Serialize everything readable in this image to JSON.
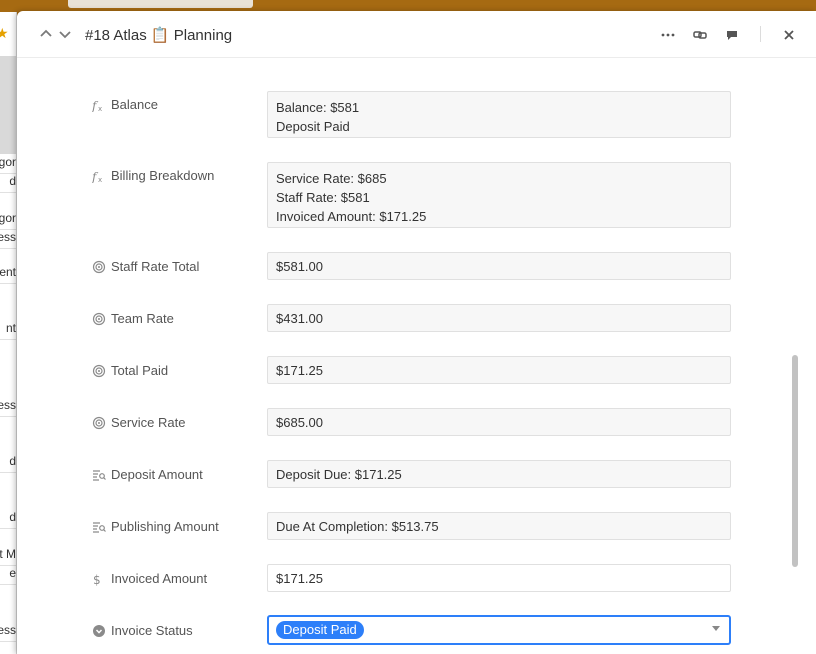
{
  "modal": {
    "record_number": "#18 Atlas",
    "record_emoji": "📋",
    "record_name": "Planning"
  },
  "background": {
    "left_cells": [
      "gor",
      "d",
      "gor",
      "ess",
      "ent",
      "nt",
      "ess",
      "d",
      "d",
      "t M",
      "e",
      "ess"
    ]
  },
  "fields": [
    {
      "label": "Balance",
      "icon": "formula-icon",
      "lines": [
        "Balance: $581",
        "Deposit Paid"
      ]
    },
    {
      "label": "Billing Breakdown",
      "icon": "formula-icon",
      "lines": [
        "Service Rate: $685",
        "Staff Rate: $581",
        "Invoiced Amount: $171.25"
      ]
    },
    {
      "label": "Staff Rate Total",
      "icon": "rollup-icon",
      "value": "$581.00"
    },
    {
      "label": "Team Rate",
      "icon": "rollup-icon",
      "value": "$431.00"
    },
    {
      "label": "Total Paid",
      "icon": "rollup-icon",
      "value": "$171.25"
    },
    {
      "label": "Service Rate",
      "icon": "rollup-icon",
      "value": "$685.00"
    },
    {
      "label": "Deposit Amount",
      "icon": "lookup-icon",
      "value": "Deposit Due: $171.25"
    },
    {
      "label": "Publishing Amount",
      "icon": "lookup-icon",
      "value": "Due At Completion: $513.75"
    },
    {
      "label": "Invoiced Amount",
      "icon": "currency-icon",
      "value": "$171.25"
    },
    {
      "label": "Invoice Status",
      "icon": "single-select-icon",
      "value": "Deposit Paid"
    }
  ],
  "colors": {
    "accent": "#2d7ff9",
    "background_app": "#a66a12"
  }
}
